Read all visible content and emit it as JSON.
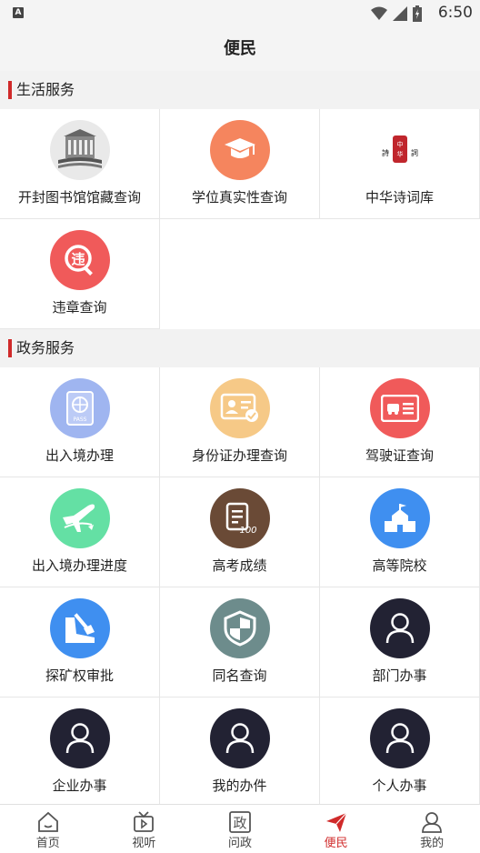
{
  "status_bar": {
    "time": "6:50",
    "notif": "A"
  },
  "header": {
    "title": "便民"
  },
  "sections": [
    {
      "title": "生活服务",
      "items": [
        {
          "label": "开封图书馆馆藏查询",
          "icon": "library-icon",
          "color": "#e9e9e9"
        },
        {
          "label": "学位真实性查询",
          "icon": "graduation-cap-icon",
          "color": "#f5855e"
        },
        {
          "label": "中华诗词库",
          "icon": "poetry-seal-icon",
          "color": "#ffffff"
        },
        {
          "label": "违章查询",
          "icon": "violation-icon",
          "color": "#f05a5a"
        }
      ]
    },
    {
      "title": "政务服务",
      "items": [
        {
          "label": "出入境办理",
          "icon": "passport-icon",
          "color": "#9fb5f0"
        },
        {
          "label": "身份证办理查询",
          "icon": "id-card-icon",
          "color": "#f6c987"
        },
        {
          "label": "驾驶证查询",
          "icon": "driver-license-icon",
          "color": "#f05a5a"
        },
        {
          "label": "出入境办理进度",
          "icon": "airplane-icon",
          "color": "#64e0a4"
        },
        {
          "label": "高考成绩",
          "icon": "exam-score-icon",
          "color": "#6a4a36"
        },
        {
          "label": "高等院校",
          "icon": "university-icon",
          "color": "#3f8ff0"
        },
        {
          "label": "探矿权审批",
          "icon": "mining-icon",
          "color": "#3f8ff0"
        },
        {
          "label": "同名查询",
          "icon": "shield-icon",
          "color": "#6d8c8c"
        },
        {
          "label": "部门办事",
          "icon": "person-icon",
          "color": "#222233"
        },
        {
          "label": "企业办事",
          "icon": "person-icon",
          "color": "#222233"
        },
        {
          "label": "我的办件",
          "icon": "person-icon",
          "color": "#222233"
        },
        {
          "label": "个人办事",
          "icon": "person-icon",
          "color": "#222233"
        }
      ]
    }
  ],
  "tabbar": {
    "tabs": [
      {
        "label": "首页",
        "icon": "home-icon"
      },
      {
        "label": "视听",
        "icon": "tv-icon"
      },
      {
        "label": "问政",
        "icon": "zheng-icon",
        "glyph": "政"
      },
      {
        "label": "便民",
        "icon": "send-icon",
        "active": true
      },
      {
        "label": "我的",
        "icon": "profile-icon"
      }
    ],
    "accent": "#d02a2a"
  }
}
